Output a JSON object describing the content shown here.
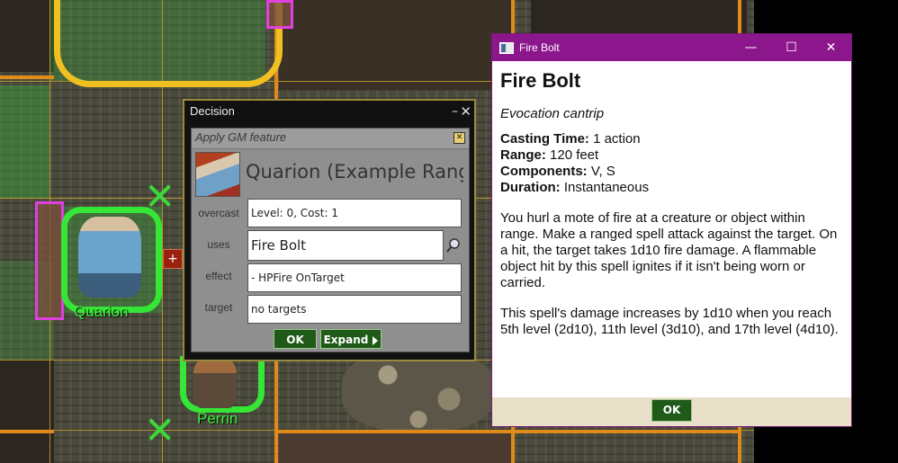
{
  "map": {
    "tokens": [
      {
        "name": "Quarion"
      },
      {
        "name": "Perrin"
      }
    ],
    "add_button": "+"
  },
  "decision": {
    "title": "Decision",
    "minimize": "–",
    "close": "✕",
    "header": "Apply GM feature",
    "header_close": "✕",
    "character": "Quarion (Example Ranger)",
    "rows": [
      {
        "label": "overcast",
        "value": "Level: 0, Cost: 1"
      },
      {
        "label": "uses",
        "value": "Fire Bolt"
      },
      {
        "label": "effect",
        "value": "- HPFire  OnTarget"
      },
      {
        "label": "target",
        "value": "no targets"
      }
    ],
    "ok_label": "OK",
    "expand_label": "Expand"
  },
  "spell_window": {
    "title": "Fire Bolt",
    "btn_min": "—",
    "btn_max": "☐",
    "btn_close": "✕",
    "name": "Fire Bolt",
    "school": "Evocation cantrip",
    "stats": [
      {
        "label": "Casting Time:",
        "value": "1 action"
      },
      {
        "label": "Range:",
        "value": "120 feet"
      },
      {
        "label": "Components:",
        "value": "V, S"
      },
      {
        "label": "Duration:",
        "value": "Instantaneous"
      }
    ],
    "description": "You hurl a mote of fire at a creature or object within range. Make a ranged spell attack against the target. On a hit, the target takes 1d10 fire damage. A flammable object hit by this spell ignites if it isn't being worn or carried.",
    "higher_levels": "This spell's damage increases by 1d10 when you reach 5th level (2d10), 11th level (3d10), and 17th level (4d10).",
    "ok_label": "OK"
  }
}
